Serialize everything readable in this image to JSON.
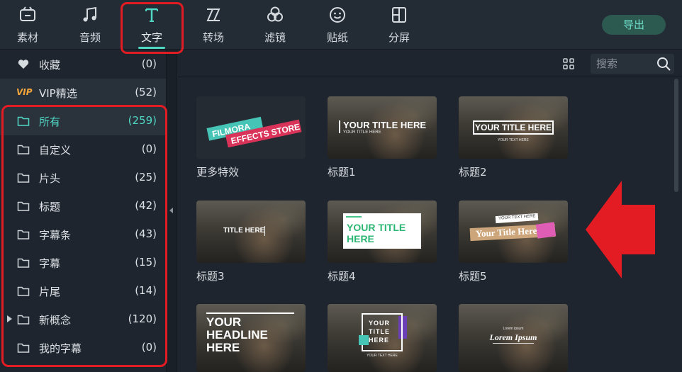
{
  "toolbar": {
    "tabs": [
      {
        "label": "素材",
        "icon": "media-icon"
      },
      {
        "label": "音频",
        "icon": "music-icon"
      },
      {
        "label": "文字",
        "icon": "text-icon"
      },
      {
        "label": "转场",
        "icon": "transition-icon"
      },
      {
        "label": "滤镜",
        "icon": "filter-icon"
      },
      {
        "label": "贴纸",
        "icon": "sticker-icon"
      },
      {
        "label": "分屏",
        "icon": "split-screen-icon"
      }
    ],
    "active_tab": "文字",
    "export_label": "导出"
  },
  "sidebar": {
    "items": [
      {
        "label": "收藏",
        "count": "(0)"
      },
      {
        "label": "VIP精选",
        "count": "(52)",
        "badge": "VIP"
      },
      {
        "label": "所有",
        "count": "(259)"
      },
      {
        "label": "自定义",
        "count": "(0)"
      },
      {
        "label": "片头",
        "count": "(25)"
      },
      {
        "label": "标题",
        "count": "(42)"
      },
      {
        "label": "字幕条",
        "count": "(43)"
      },
      {
        "label": "字幕",
        "count": "(15)"
      },
      {
        "label": "片尾",
        "count": "(14)"
      },
      {
        "label": "新概念",
        "count": "(120)"
      },
      {
        "label": "我的字幕",
        "count": "(0)"
      }
    ]
  },
  "search": {
    "placeholder": "搜索"
  },
  "tiles": [
    {
      "label": "更多特效",
      "line1": "FILMORA",
      "line2": "EFFECTS STORE"
    },
    {
      "label": "标题1",
      "title": "YOUR TITLE HERE",
      "sub": "YOUR TITLE HERE"
    },
    {
      "label": "标题2",
      "title": "YOUR TITLE HERE",
      "sub": "YOUR TEXT HERE"
    },
    {
      "label": "标题3",
      "title": "TITLE HERE"
    },
    {
      "label": "标题4",
      "title_a": "YOUR TITLE",
      "title_b": "HERE"
    },
    {
      "label": "标题5",
      "small": "YOUR TEXT HERE",
      "title": "Your Title Here"
    },
    {
      "label": "",
      "l1": "YOUR",
      "l2": "HEADLINE",
      "l3": "HERE"
    },
    {
      "label": "",
      "l1": "YOUR",
      "l2": "TITLE",
      "l3": "HERE",
      "sub": "YOUR TEXT HERE"
    },
    {
      "label": "",
      "small": "Lorem ipsum",
      "title": "Lorem Ipsum"
    }
  ],
  "colors": {
    "accent": "#4fd7c3",
    "highlight": "#e31b23",
    "vip": "#f3a73a"
  }
}
